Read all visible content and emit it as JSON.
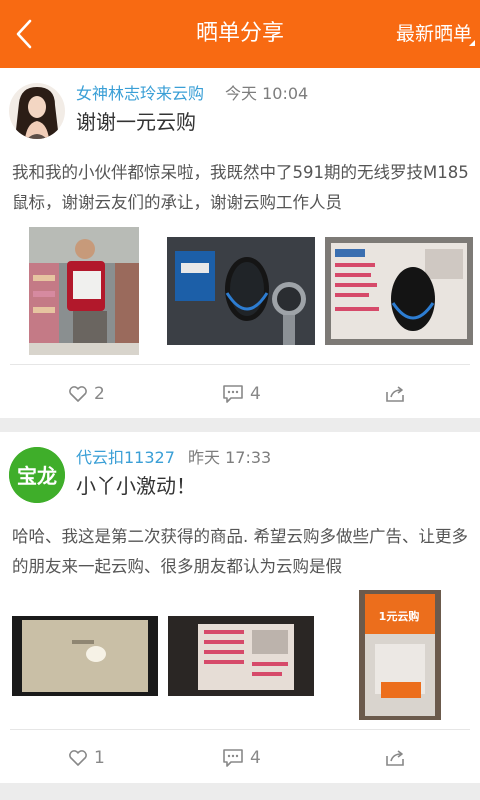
{
  "header": {
    "title": "晒单分享",
    "right_action": "最新晒单"
  },
  "posts": [
    {
      "username": "女神林志玲来云购",
      "time": "今天 10:04",
      "headline": "谢谢一元云购",
      "body": "我和我的小伙伴都惊呆啦，我既然中了591期的无线罗技M185鼠标，谢谢云友们的承让，谢谢云购工作人员",
      "likes": "2",
      "comments": "4"
    },
    {
      "username": "代云扣11327",
      "time": "昨天 17:33",
      "headline": "小丫小激动！",
      "body": "哈哈、我这是第二次获得的商品. 希望云购多做些广告、让更多的朋友来一起云购、很多朋友都认为云购是假",
      "avatar_text": "宝龙",
      "photo_text": "1元云购",
      "likes": "1",
      "comments": "4"
    }
  ],
  "colors": {
    "header": "#f86a12",
    "username": "#3a9fd6",
    "avatar_green": "#3fae2a"
  }
}
